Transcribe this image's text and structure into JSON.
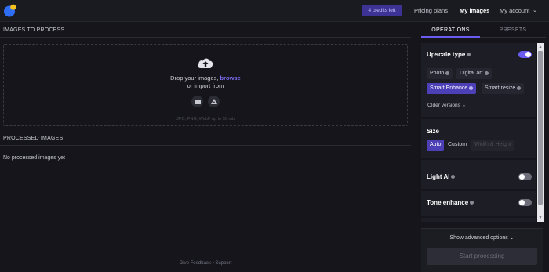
{
  "topbar": {
    "credits": "4 credits left",
    "nav": [
      "Pricing plans",
      "My images",
      "My account"
    ]
  },
  "main": {
    "images_title": "IMAGES TO PROCESS",
    "drop_text": "Drop your images,",
    "browse": "browse",
    "import_text": "or import from",
    "hint": "JPG, PNG, WebP up to 50 mb",
    "processed_title": "PROCESSED IMAGES",
    "empty_note": "No processed images yet",
    "footer_feedback": "Give Feedback",
    "footer_sep": "•",
    "footer_support": "Support"
  },
  "panel": {
    "tabs": [
      "OPERATIONS",
      "PRESETS"
    ],
    "upscale": {
      "title": "Upscale type",
      "enabled": true,
      "options": [
        "Photo",
        "Digital art",
        "Smart Enhance",
        "Smart resize"
      ],
      "selected": "Smart Enhance",
      "older": "Older versions"
    },
    "size": {
      "title": "Size",
      "options": [
        "Auto",
        "Custom",
        "Width & Height"
      ],
      "selected": "Auto"
    },
    "light_ai": {
      "title": "Light AI",
      "enabled": false
    },
    "tone": {
      "title": "Tone enhance",
      "enabled": false
    },
    "advanced": "Show advanced options",
    "start": "Start processing"
  },
  "colors": {
    "accent": "#6a5cf0",
    "selected_chip": "#4d3fb6",
    "background": "#15151b"
  }
}
